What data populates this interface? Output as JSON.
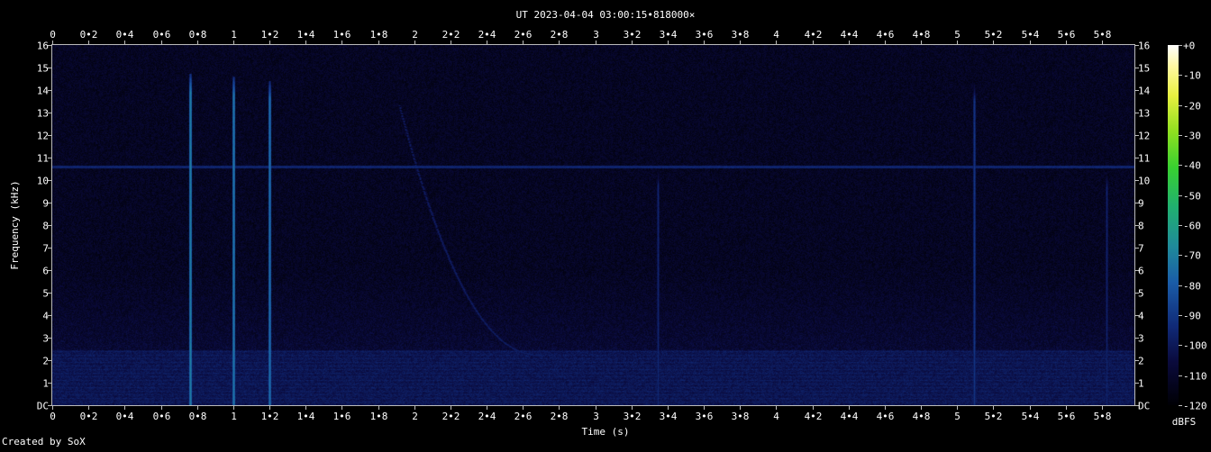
{
  "chart_data": {
    "type": "heatmap",
    "title": "UT 2023-04-04 03:00:15•818000×",
    "xlabel": "Time (s)",
    "ylabel": "Frequency (kHz)",
    "xlim": [
      0,
      5.98
    ],
    "ylim": [
      0,
      16
    ],
    "x_ticks": [
      "0",
      "0•2",
      "0•4",
      "0•6",
      "0•8",
      "1",
      "1•2",
      "1•4",
      "1•6",
      "1•8",
      "2",
      "2•2",
      "2•4",
      "2•6",
      "2•8",
      "3",
      "3•2",
      "3•4",
      "3•6",
      "3•8",
      "4",
      "4•2",
      "4•4",
      "4•6",
      "4•8",
      "5",
      "5•2",
      "5•4",
      "5•6",
      "5•8"
    ],
    "x_tick_values": [
      0,
      0.2,
      0.4,
      0.6,
      0.8,
      1,
      1.2,
      1.4,
      1.6,
      1.8,
      2,
      2.2,
      2.4,
      2.6,
      2.8,
      3,
      3.2,
      3.4,
      3.6,
      3.8,
      4,
      4.2,
      4.4,
      4.6,
      4.8,
      5,
      5.2,
      5.4,
      5.6,
      5.8
    ],
    "y_ticks": [
      "DC",
      "1",
      "2",
      "3",
      "4",
      "5",
      "6",
      "7",
      "8",
      "9",
      "10",
      "11",
      "12",
      "13",
      "14",
      "15",
      "16"
    ],
    "y_tick_values": [
      0,
      1,
      2,
      3,
      4,
      5,
      6,
      7,
      8,
      9,
      10,
      11,
      12,
      13,
      14,
      15,
      16
    ],
    "colorbar": {
      "label": "dBFS",
      "ticks": [
        "+0",
        "-10",
        "-20",
        "-30",
        "-40",
        "-50",
        "-60",
        "-70",
        "-80",
        "-90",
        "-100",
        "-110",
        "-120"
      ],
      "tick_values": [
        0,
        -10,
        -20,
        -30,
        -40,
        -50,
        -60,
        -70,
        -80,
        -90,
        -100,
        -110,
        -120
      ],
      "range": [
        -120,
        0
      ]
    },
    "features": {
      "background_level_dbfs": -112,
      "broadband_impulses": [
        {
          "t": 0.76,
          "fmax_khz": 14.7,
          "level_dbfs": -70
        },
        {
          "t": 1.0,
          "fmax_khz": 14.6,
          "level_dbfs": -72
        },
        {
          "t": 1.2,
          "fmax_khz": 14.4,
          "level_dbfs": -74
        },
        {
          "t": 5.1,
          "fmax_khz": 14.3,
          "level_dbfs": -90
        },
        {
          "t": 3.35,
          "fmax_khz": 10.5,
          "level_dbfs": -95
        },
        {
          "t": 5.83,
          "fmax_khz": 10.5,
          "level_dbfs": -96
        }
      ],
      "horizontal_tone_khz": 10.6,
      "low_band_khz": [
        0.3,
        2.4
      ],
      "whistler_sweep": {
        "t_start": 1.92,
        "f_start_khz": 13.3,
        "t_end": 2.7,
        "f_end_khz": 2.2
      }
    },
    "grid": false
  },
  "footer": {
    "credit": "Created by SoX"
  }
}
